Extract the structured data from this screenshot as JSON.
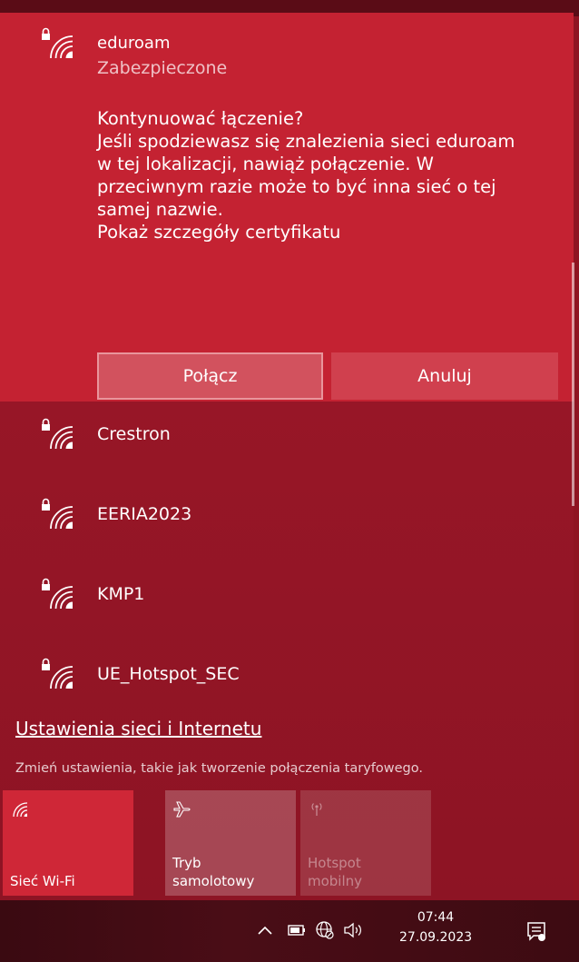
{
  "expanded_network": {
    "name": "eduroam",
    "status": "Zabezpieczone",
    "prompt_lines": [
      "Kontynuować łączenie?",
      "Jeśli spodziewasz się znalezienia sieci eduroam",
      "w tej lokalizacji, nawiąż połączenie. W",
      "przeciwnym razie może to być inna sieć o tej",
      "samej nazwie.",
      "Pokaż szczegóły certyfikatu"
    ],
    "connect_label": "Połącz",
    "cancel_label": "Anuluj"
  },
  "networks": [
    {
      "name": "Crestron"
    },
    {
      "name": "EERIA2023"
    },
    {
      "name": "KMP1"
    },
    {
      "name": "UE_Hotspot_SEC"
    }
  ],
  "settings": {
    "link": "Ustawienia sieci i Internetu",
    "description": "Zmień ustawienia, takie jak tworzenie połączenia taryfowego."
  },
  "quick_actions": {
    "wifi": {
      "label": "Sieć Wi-Fi",
      "icon": "wifi-icon",
      "state": "on"
    },
    "airplane": {
      "label_line1": "Tryb",
      "label_line2": "samolotowy",
      "icon": "airplane-icon",
      "state": "off"
    },
    "hotspot": {
      "label_line1": "Hotspot",
      "label_line2": "mobilny",
      "icon": "hotspot-icon",
      "state": "disabled"
    }
  },
  "taskbar": {
    "time": "07:44",
    "date": "27.09.2023",
    "icons": [
      "chevron-up-icon",
      "battery-icon",
      "network-globe-icon",
      "volume-icon",
      "notification-icon"
    ]
  },
  "colors": {
    "accent": "#c42232",
    "background": "#981627",
    "taskbar": "#3a0a11"
  }
}
